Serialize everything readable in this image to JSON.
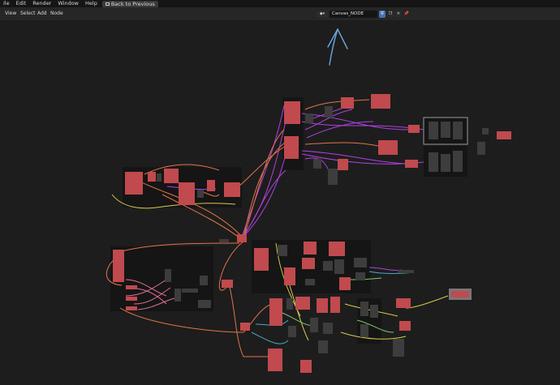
{
  "menubar": {
    "items": [
      "ile",
      "Edit",
      "Render",
      "Window",
      "Help"
    ],
    "back_label": "Back to Previous"
  },
  "toolbar": {
    "items": [
      "View",
      "Select",
      "Add",
      "Node"
    ]
  },
  "node_tree": {
    "name": "Canvas_NODE",
    "type_icon": "node-tree-icon"
  },
  "colors": {
    "accent_blue": "#4772b3",
    "node_red": "#c04a4e",
    "node_dark": "#3d3d3d",
    "frame": "#151515",
    "wire_purple": "#b040e0",
    "wire_orange": "#e0744a",
    "wire_yellow": "#d8c848",
    "wire_teal": "#4aa8c0",
    "wire_green": "#7cc86c",
    "annotation_arrow": "#6aa8e0"
  }
}
